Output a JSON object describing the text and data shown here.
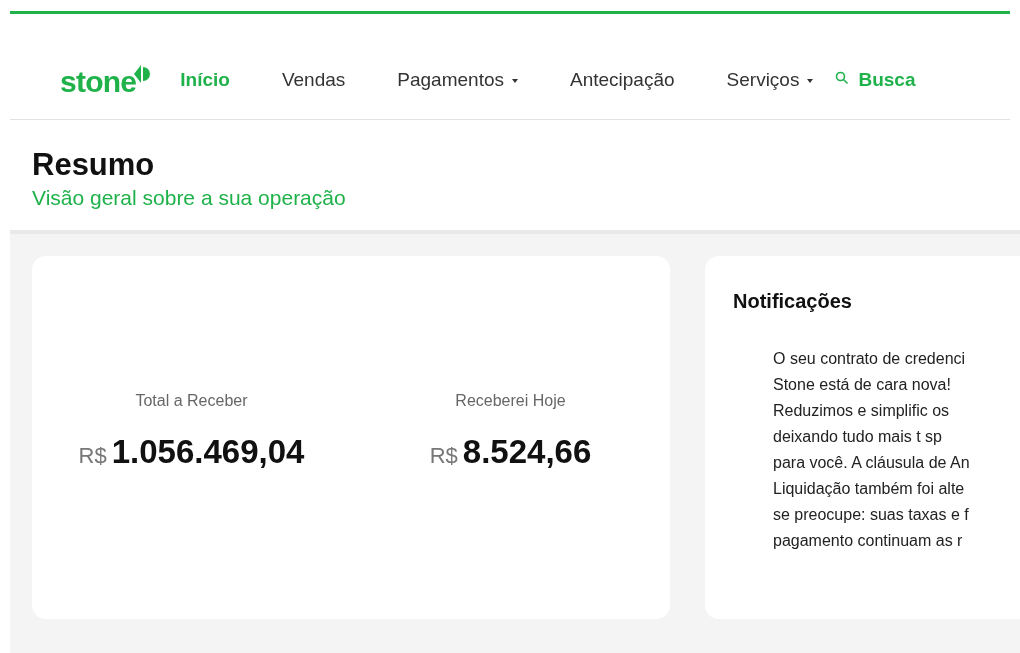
{
  "logo": {
    "text": "stone"
  },
  "nav": [
    {
      "label": "Início",
      "selected": true,
      "dropdown": false
    },
    {
      "label": "Vendas",
      "selected": false,
      "dropdown": false
    },
    {
      "label": "Pagamentos",
      "selected": false,
      "dropdown": true
    },
    {
      "label": "Antecipação",
      "selected": false,
      "dropdown": false
    },
    {
      "label": "Serviços",
      "selected": false,
      "dropdown": true
    }
  ],
  "search": {
    "label": "Busca"
  },
  "header": {
    "title": "Resumo",
    "subtitle": "Visão geral sobre a sua operação"
  },
  "summary": [
    {
      "label": "Total a Receber",
      "currency": "R$",
      "amount": "1.056.469,04"
    },
    {
      "label": "Receberei Hoje",
      "currency": "R$",
      "amount": "8.524,66"
    }
  ],
  "notifications": {
    "title": "Notificações",
    "lines": [
      "O seu contrato de credenci",
      "Stone está de cara nova!",
      "Reduzimos e simplific os",
      "deixando tudo mais t sp",
      "para você. A cláusula de An",
      "Liquidação também foi alte",
      "se preocupe: suas taxas e f",
      "pagamento continuam as r"
    ]
  }
}
